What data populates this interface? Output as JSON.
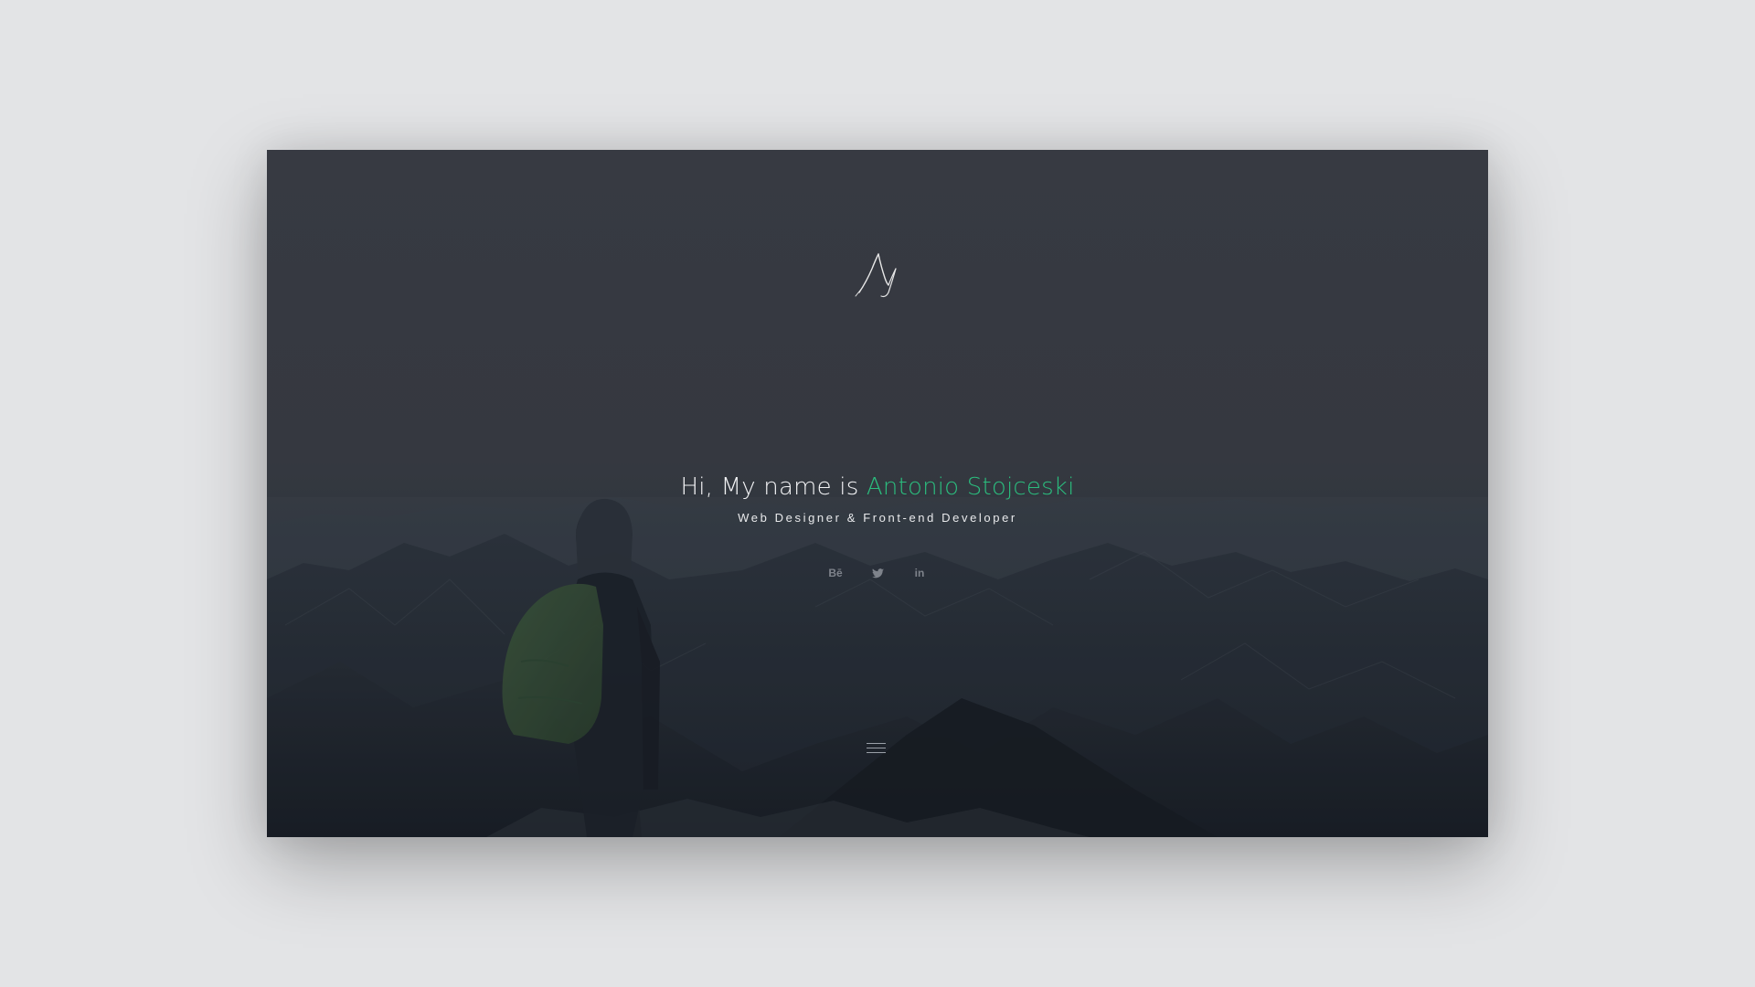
{
  "logo": {
    "icon": "signature-logo",
    "color": "#e8e8e8"
  },
  "hero": {
    "greeting": "Hi, My name is ",
    "name": "Antonio Stojceski",
    "subtitle": "Web Designer & Front-end Developer"
  },
  "social": [
    {
      "icon": "behance-icon",
      "label": "Bē"
    },
    {
      "icon": "twitter-icon",
      "label": ""
    },
    {
      "icon": "linkedin-icon",
      "label": "in"
    }
  ],
  "menu": {
    "icon": "hamburger-menu-icon"
  },
  "colors": {
    "accent": "#2bbd7e",
    "background_top": "#3c3f47",
    "background_bottom": "#1b2029",
    "page": "#e3e4e6"
  }
}
